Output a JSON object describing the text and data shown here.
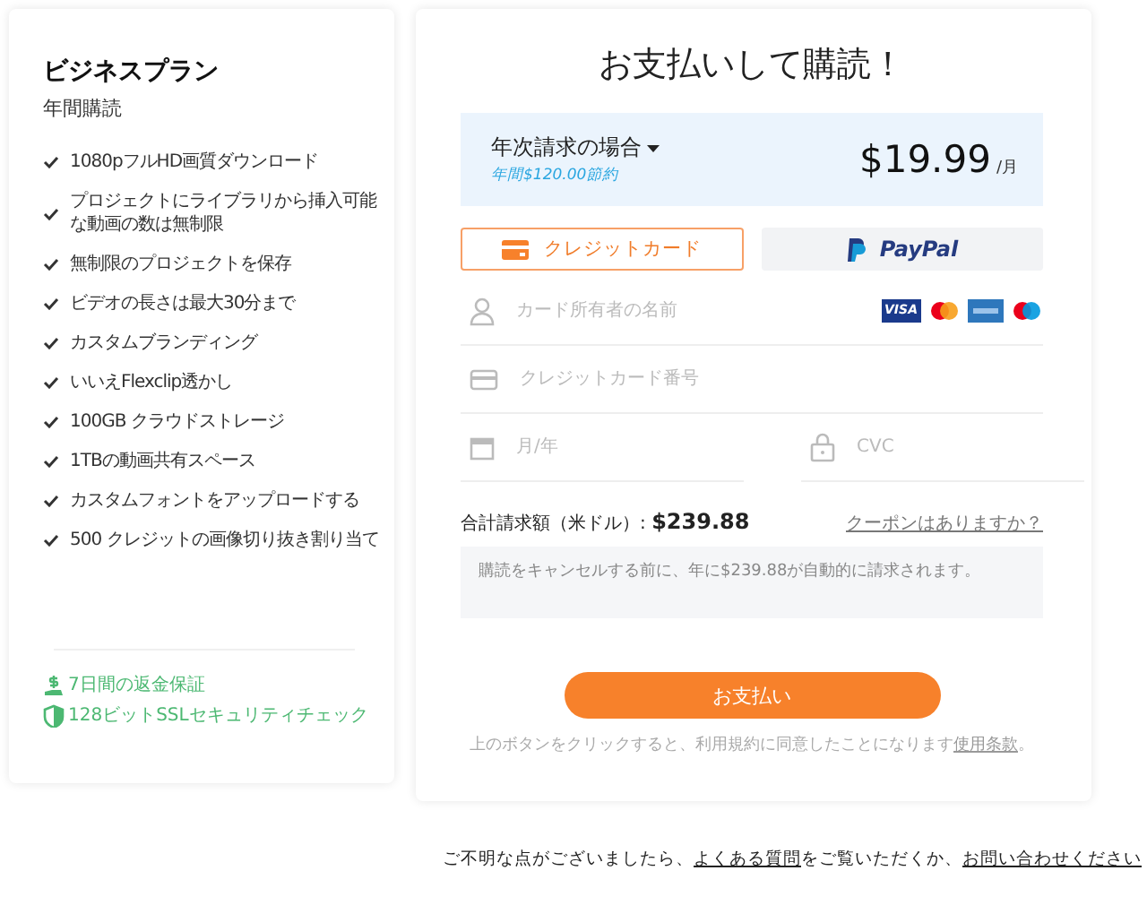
{
  "plan": {
    "title": "ビジネスプラン",
    "subtitle": "年間購読",
    "features": [
      "1080pフルHD画質ダウンロード",
      "プロジェクトにライブラリから挿入可能な動画の数は無制限",
      "無制限のプロジェクトを保存",
      "ビデオの長さは最大30分まで",
      "カスタムブランディング",
      "いいえFlexclip透かし",
      "100GB クラウドストレージ",
      "1TBの動画共有スペース",
      "カスタムフォントをアップロードする",
      "500 クレジットの画像切り抜き割り当て"
    ],
    "guarantees": [
      {
        "kind": "money",
        "text": "7日間の返金保証"
      },
      {
        "kind": "shield",
        "text": "128ビットSSLセキュリティチェック"
      }
    ]
  },
  "checkout": {
    "title": "お支払いして購読！",
    "billing": {
      "label": "年次請求の場合",
      "savings": "年間$120.00節約",
      "price": "$19.99",
      "unit": "/月"
    },
    "methods": [
      {
        "kind": "card",
        "label": "クレジットカード",
        "selected": true
      },
      {
        "kind": "paypal",
        "label": "PayPal",
        "selected": false
      }
    ],
    "fields": [
      {
        "kind": "person",
        "placeholder": "カード所有者の名前",
        "brands": [
          "VISA"
        ]
      },
      {
        "kind": "card",
        "placeholder": "クレジットカード番号"
      },
      {
        "kind": "calendar",
        "placeholder": "月/年"
      },
      {
        "kind": "lock",
        "placeholder": "CVC"
      }
    ],
    "total_label": "合計請求額（米ドル）:",
    "total": "$239.88",
    "coupon": "クーポンはありますか？",
    "notice": "購読をキャンセルする前に、年に$239.88が自動的に請求されます。",
    "pay_button": "お支払い",
    "terms": [
      {
        "text": "上のボタンをクリックすると、利用規約に同意したことになります",
        "link": false
      },
      {
        "text": "使用条款",
        "link": true
      },
      {
        "text": "。",
        "link": false
      }
    ]
  },
  "footer": [
    {
      "text": "ご不明な点がございましたら、",
      "link": false
    },
    {
      "text": "よくある質問",
      "link": true
    },
    {
      "text": "をご覧いただくか、",
      "link": false
    },
    {
      "text": "お問い合わせください",
      "link": true
    }
  ]
}
